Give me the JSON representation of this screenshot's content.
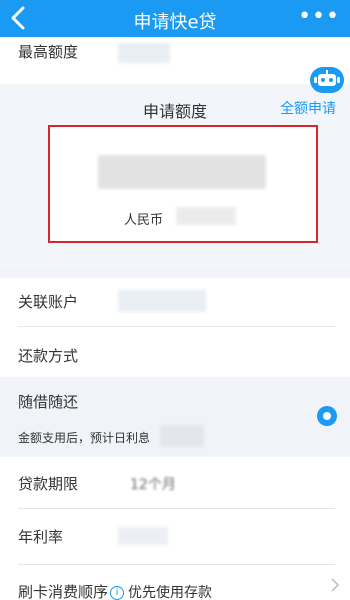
{
  "nav": {
    "title": "申请快e贷",
    "more_label": "•••"
  },
  "max_limit": {
    "label": "最高额度"
  },
  "apply": {
    "heading": "申请额度",
    "all_apply": "全额申请",
    "currency": "人民币"
  },
  "linked_account": {
    "label": "关联账户"
  },
  "repayment": {
    "label": "还款方式",
    "option_title": "随借随还",
    "option_desc": "金额支用后，预计日利息"
  },
  "term": {
    "label": "贷款期限",
    "value": "12个月"
  },
  "rate": {
    "label": "年利率"
  },
  "card_order": {
    "label": "刷卡消费顺序",
    "info_icon": "i",
    "value": "优先使用存款"
  },
  "colors": {
    "brand": "#1a9af2",
    "highlight_border": "#d9252b"
  }
}
